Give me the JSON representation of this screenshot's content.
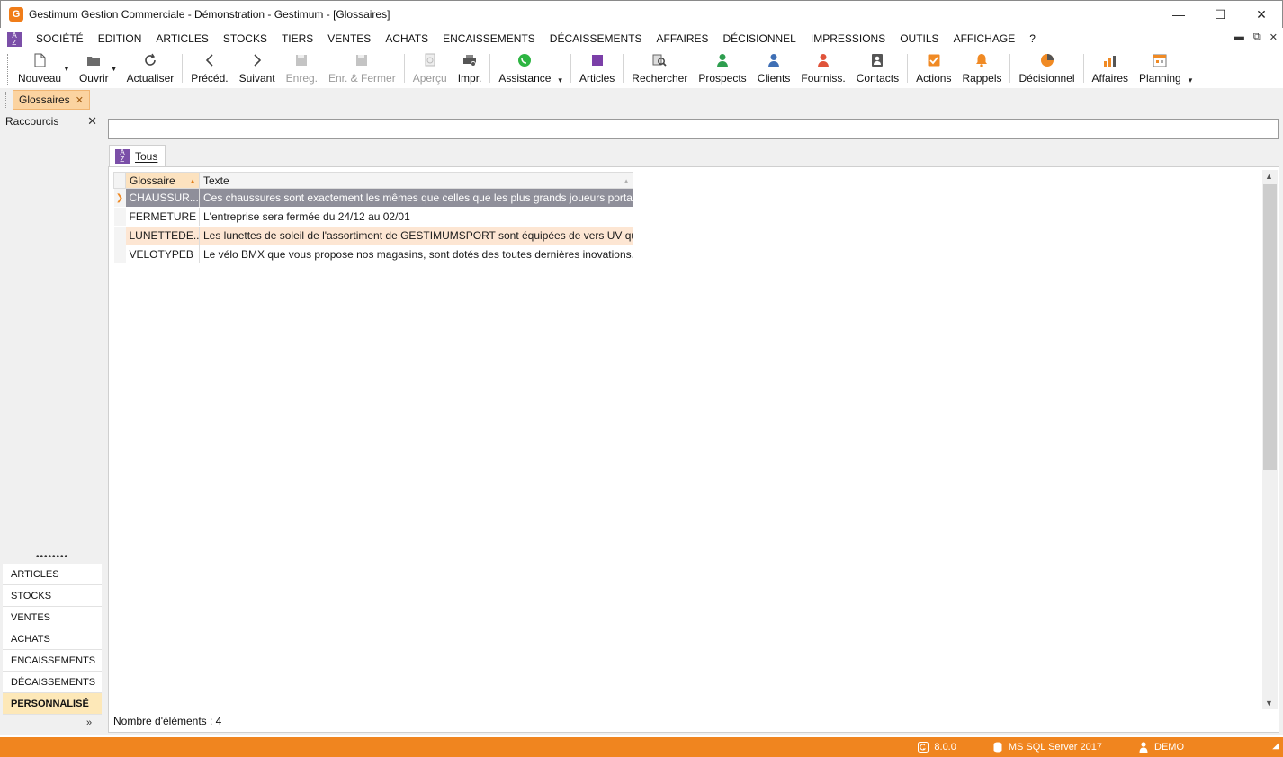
{
  "window": {
    "title": "Gestimum Gestion Commerciale - Démonstration - Gestimum - [Glossaires]",
    "app_icon_letter": "G",
    "controls": {
      "minimize": "—",
      "maximize": "☐",
      "close": "✕"
    }
  },
  "menu": {
    "items": [
      "SOCIÉTÉ",
      "EDITION",
      "ARTICLES",
      "STOCKS",
      "TIERS",
      "VENTES",
      "ACHATS",
      "ENCAISSEMENTS",
      "DÉCAISSEMENTS",
      "AFFAIRES",
      "DÉCISIONNEL",
      "IMPRESSIONS",
      "OUTILS",
      "AFFICHAGE",
      "?"
    ],
    "right_controls": [
      "▬",
      "⧉",
      "✕"
    ]
  },
  "toolbar": {
    "nouveau": "Nouveau",
    "ouvrir": "Ouvrir",
    "actualiser": "Actualiser",
    "preced": "Précéd.",
    "suivant": "Suivant",
    "enreg": "Enreg.",
    "enr_fermer": "Enr. & Fermer",
    "apercu": "Aperçu",
    "impr": "Impr.",
    "assistance": "Assistance",
    "articles": "Articles",
    "rechercher": "Rechercher",
    "prospects": "Prospects",
    "clients": "Clients",
    "fourniss": "Fourniss.",
    "contacts": "Contacts",
    "actions": "Actions",
    "rappels": "Rappels",
    "decisionnel": "Décisionnel",
    "affaires": "Affaires",
    "planning": "Planning"
  },
  "colors": {
    "accent": "#f0851f",
    "selected_row": "#8f8f9a",
    "alt_row": "#fde6d3",
    "prospects": "#2e9e4f",
    "clients": "#3f6fb5",
    "fourniss": "#e0533a"
  },
  "doc_tab": {
    "label": "Glossaires",
    "close": "✕"
  },
  "left_panel": {
    "title": "Raccourcis",
    "close": "✕",
    "dots": "••••••••",
    "nav": [
      "ARTICLES",
      "STOCKS",
      "VENTES",
      "ACHATS",
      "ENCAISSEMENTS",
      "DÉCAISSEMENTS",
      "PERSONNALISÉ"
    ],
    "expand": "»"
  },
  "main": {
    "search_value": "",
    "view_tab": "Tous",
    "columns": [
      "Glossaire",
      "Texte"
    ],
    "rows": [
      {
        "glossaire": "CHAUSSUR...",
        "texte": "Ces chaussures sont exactement les mêmes que celles que les plus grands joueurs portai..."
      },
      {
        "glossaire": "FERMETURE",
        "texte": "L'entreprise sera fermée du 24/12 au 02/01"
      },
      {
        "glossaire": "LUNETTEDE...",
        "texte": "Les lunettes de soleil de l'assortiment de GESTIMUMSPORT sont équipées de vers UV qui..."
      },
      {
        "glossaire": "VELOTYPEB",
        "texte": "Le vélo BMX que vous propose nos magasins, sont dotés des toutes dernières inovations..."
      }
    ],
    "count_label": "Nombre d'éléments : 4"
  },
  "statusbar": {
    "version": "8.0.0",
    "server": "MS SQL Server 2017",
    "user": "DEMO"
  }
}
